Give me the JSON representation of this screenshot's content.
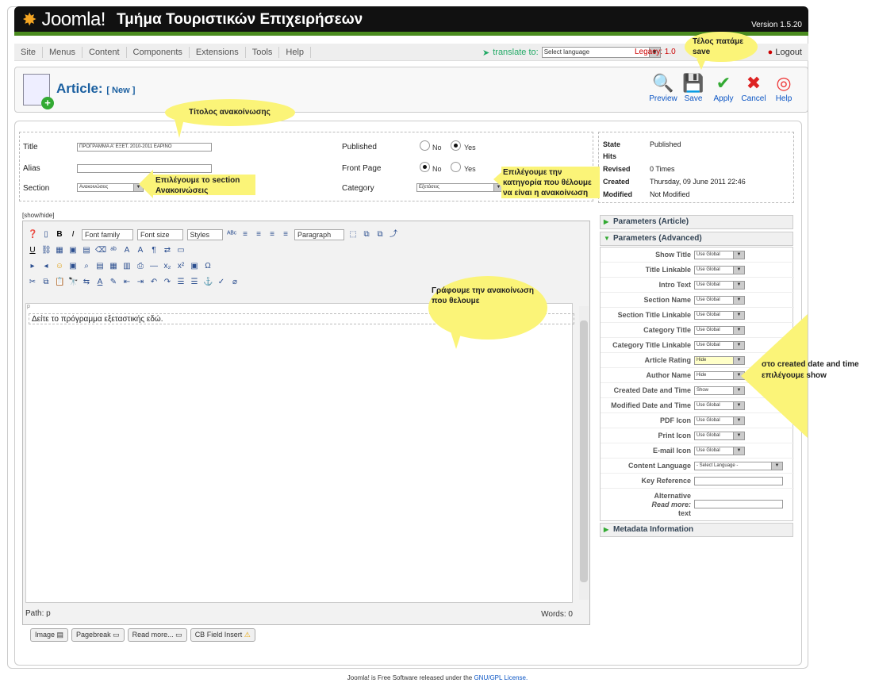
{
  "header": {
    "brand": "Joomla!",
    "site_name": "Τμήμα Τουριστικών Επιχειρήσεων",
    "version": "Version 1.5.20"
  },
  "menubar": {
    "items": [
      "Site",
      "Menus",
      "Content",
      "Components",
      "Extensions",
      "Tools",
      "Help"
    ],
    "translate_label": "translate to:",
    "translate_select": "Select language",
    "legacy": "Legacy: 1.0",
    "logout": "Logout"
  },
  "toolbar": {
    "title": "Article:",
    "title_tag": "[ New ]",
    "buttons": [
      "Preview",
      "Save",
      "Apply",
      "Cancel",
      "Help"
    ]
  },
  "form": {
    "title_label": "Title",
    "title_value": "ΠΡΟΓΡΑΜΜΑ Α' ΕΞΕΤ. 2010-2011 ΕΑΡΙΝΟ",
    "alias_label": "Alias",
    "alias_value": "",
    "section_label": "Section",
    "section_value": "Ανακοινώσεις",
    "published_label": "Published",
    "frontpage_label": "Front Page",
    "category_label": "Category",
    "category_value": "Εξετάσεις",
    "no": "No",
    "yes": "Yes"
  },
  "info": {
    "state_label": "State",
    "state_value": "Published",
    "hits_label": "Hits",
    "hits_value": "",
    "revised_label": "Revised",
    "revised_value": "0 Times",
    "created_label": "Created",
    "created_value": "Thursday, 09 June 2011 22:46",
    "modified_label": "Modified",
    "modified_value": "Not Modified"
  },
  "editor": {
    "showhide": "[show/hide]",
    "font_family": "Font family",
    "font_size": "Font size",
    "styles": "Styles",
    "paragraph": "Paragraph",
    "content_marker": "p",
    "content": "Δείτε το πρόγραμμα εξεταστικής εδώ.",
    "path": "Path: p",
    "words": "Words: 0",
    "buttons": [
      "Image",
      "Pagebreak",
      "Read more...",
      "CB Field Insert"
    ]
  },
  "params": {
    "article_header": "Parameters (Article)",
    "advanced_header": "Parameters (Advanced)",
    "metadata_header": "Metadata Information",
    "rows": [
      {
        "label": "Show Title",
        "value": "Use Global"
      },
      {
        "label": "Title Linkable",
        "value": "Use Global"
      },
      {
        "label": "Intro Text",
        "value": "Use Global"
      },
      {
        "label": "Section Name",
        "value": "Use Global"
      },
      {
        "label": "Section Title Linkable",
        "value": "Use Global"
      },
      {
        "label": "Category Title",
        "value": "Use Global"
      },
      {
        "label": "Category Title Linkable",
        "value": "Use Global"
      },
      {
        "label": "Article Rating",
        "value": "Hide"
      },
      {
        "label": "Author Name",
        "value": "Hide"
      },
      {
        "label": "Created Date and Time",
        "value": "Show"
      },
      {
        "label": "Modified Date and Time",
        "value": "Use Global"
      },
      {
        "label": "PDF Icon",
        "value": "Use Global"
      },
      {
        "label": "Print Icon",
        "value": "Use Global"
      },
      {
        "label": "E-mail Icon",
        "value": "Use Global"
      },
      {
        "label": "Content Language",
        "value": "- Select Language -"
      }
    ],
    "key_reference": "Key Reference",
    "alt_readmore_1": "Alternative",
    "alt_readmore_2": "Read more:",
    "alt_readmore_3": "text"
  },
  "callouts": {
    "save_note": "Τέλος πατάμε save",
    "title_note": "Τίτολος ανακοίνωσης",
    "section_note": "Επιλέγουμε το section Ανακοινώσεις",
    "category_note": "Επιλέγουμε την κατηγορία που θέλουμε να είναι η ανακοίνωση",
    "content_note": "Γράφουμε την ανακοίνωση που θελουμε",
    "created_note": "στο created date and time επιλέγουμε show"
  },
  "footer": {
    "text": "Joomla! is Free Software released under the",
    "link": "GNU/GPL License."
  }
}
